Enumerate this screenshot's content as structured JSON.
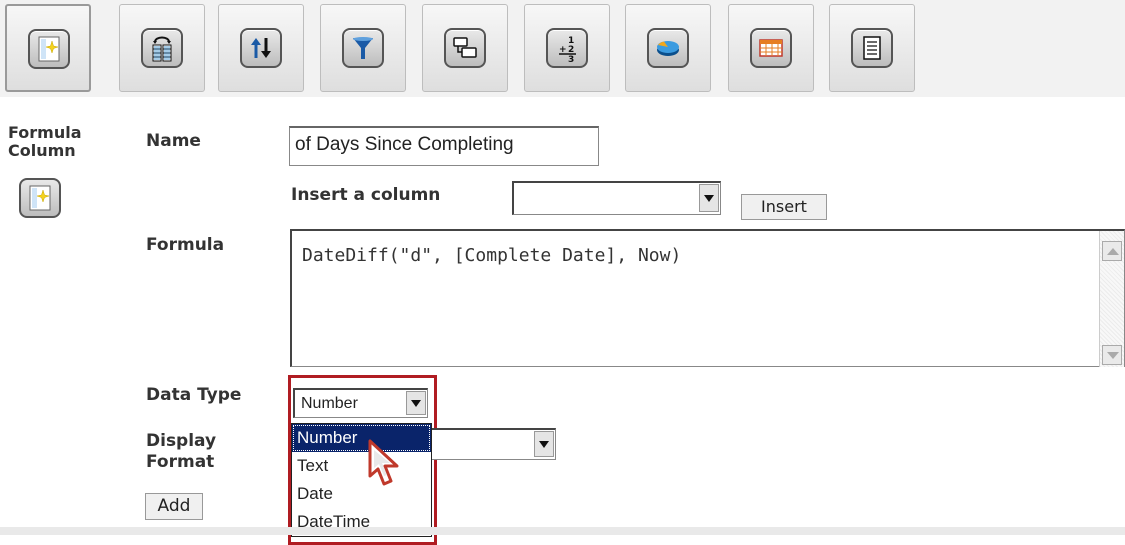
{
  "toolbar": {
    "buttons": [
      {
        "icon": "formula-column-icon"
      },
      {
        "icon": "choose-columns-icon"
      },
      {
        "icon": "sort-icon"
      },
      {
        "icon": "filter-icon"
      },
      {
        "icon": "group-icon"
      },
      {
        "icon": "aggregate-icon"
      },
      {
        "icon": "chart-icon"
      },
      {
        "icon": "crosstab-icon"
      },
      {
        "icon": "layout-icon"
      }
    ]
  },
  "section": {
    "title": "Formula Column",
    "icon": "formula-column-icon"
  },
  "form": {
    "name_label": "Name",
    "name_value": "of Days Since Completing",
    "insert_column_label": "Insert a column",
    "insert_column_value": "",
    "insert_button": "Insert",
    "formula_label": "Formula",
    "formula_value": "DateDiff(\"d\", [Complete Date], Now)",
    "data_type_label": "Data Type",
    "data_type_value": "Number",
    "data_type_options": [
      "Number",
      "Text",
      "Date",
      "DateTime"
    ],
    "display_format_label": "Display Format",
    "display_format_value": "",
    "add_button": "Add"
  },
  "colors": {
    "highlight_border": "#b01c22",
    "selected_option_bg": "#0a246a"
  }
}
